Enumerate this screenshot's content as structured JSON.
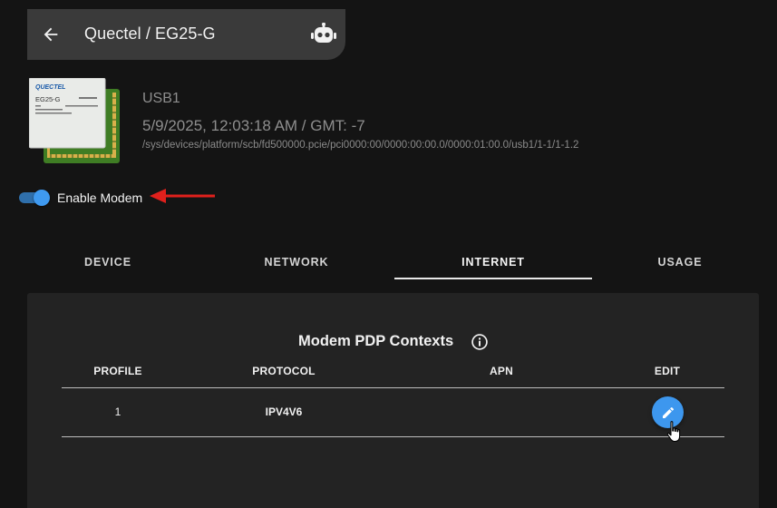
{
  "header": {
    "title": "Quectel / EG25-G",
    "back_icon": "arrow-left-icon",
    "robot_icon": "robot-icon"
  },
  "device": {
    "image_brand": "QUECTEL",
    "image_model": "EG25-G",
    "port": "USB1",
    "datetime": "5/9/2025, 12:03:18 AM / GMT: -7",
    "path": "/sys/devices/platform/scb/fd500000.pcie/pci0000:00/0000:00:00.0/0000:01:00.0/usb1/1-1/1-1.2"
  },
  "enable_modem": {
    "label": "Enable Modem",
    "checked": true
  },
  "tabs": [
    {
      "label": "DEVICE",
      "active": false
    },
    {
      "label": "NETWORK",
      "active": false
    },
    {
      "label": "INTERNET",
      "active": true
    },
    {
      "label": "USAGE",
      "active": false
    }
  ],
  "pdp": {
    "title": "Modem PDP Contexts",
    "headers": [
      "PROFILE",
      "PROTOCOL",
      "APN",
      "EDIT"
    ],
    "rows": [
      {
        "profile": "1",
        "protocol": "IPV4V6",
        "apn": ""
      }
    ]
  },
  "colors": {
    "background": "#141414",
    "accent": "#3d97ee",
    "annotation_arrow": "#e0201c"
  }
}
